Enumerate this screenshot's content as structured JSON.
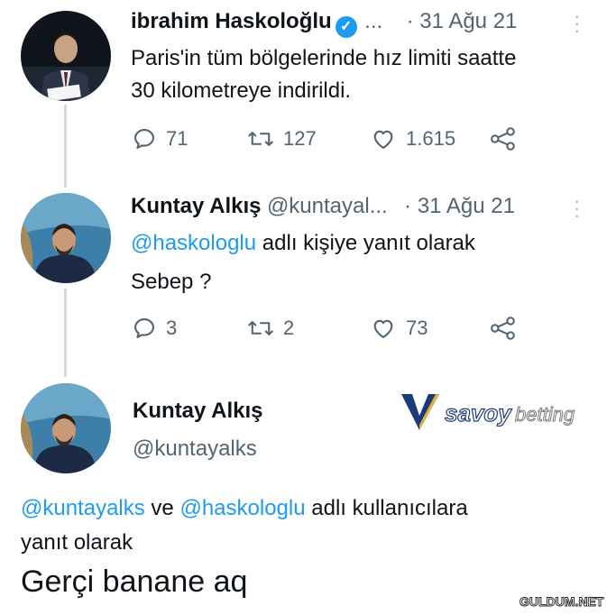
{
  "tweets": [
    {
      "name": "ibrahim Haskoloğlu",
      "handle": "...",
      "date": "· 31 Ağu 21",
      "text_line1": "Paris'in tüm bölgelerinde hız limiti saatte",
      "text_line2": "30 kilometreye indirildi.",
      "replies": "71",
      "retweets": "127",
      "likes": "1.615"
    },
    {
      "name": "Kuntay Alkış",
      "handle": "@kuntayal...",
      "date": "· 31 Ağu 21",
      "reply_to_mention": "@haskologlu",
      "reply_to_suffix": " adlı kişiye yanıt olarak",
      "text": "Sebep ?",
      "replies": "3",
      "retweets": "2",
      "likes": "73"
    }
  ],
  "focused_tweet": {
    "name": "Kuntay Alkış",
    "handle": "@kuntayalks",
    "reply_mention1": "@kuntayalks",
    "reply_connector": " ve ",
    "reply_mention2": "@haskologlu",
    "reply_suffix": " adlı kullanıcılara",
    "reply_line2": "yanıt olarak",
    "text": "Gerçi banane aq"
  },
  "watermarks": {
    "ad_logo_text": "savoybetting",
    "site_logo_text": "GULDUM.NET"
  },
  "colors": {
    "link": "#1d9bf0",
    "muted": "#536471",
    "thread_line": "#cfd9de"
  }
}
